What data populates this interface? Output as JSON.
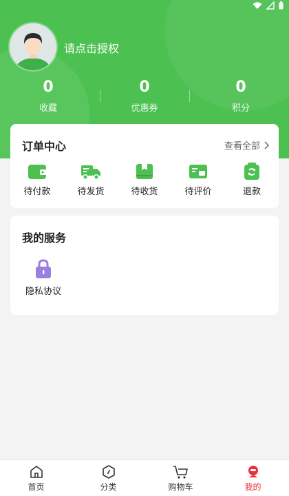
{
  "header": {
    "login_prompt": "请点击授权",
    "stats": [
      {
        "value": "0",
        "label": "收藏"
      },
      {
        "value": "0",
        "label": "优惠券"
      },
      {
        "value": "0",
        "label": "积分"
      }
    ]
  },
  "order_center": {
    "title": "订单中心",
    "view_all": "查看全部",
    "items": [
      {
        "label": "待付款",
        "icon": "wallet-icon"
      },
      {
        "label": "待发货",
        "icon": "truck-icon"
      },
      {
        "label": "待收货",
        "icon": "package-icon"
      },
      {
        "label": "待评价",
        "icon": "review-icon"
      },
      {
        "label": "退款",
        "icon": "refund-icon"
      }
    ]
  },
  "services": {
    "title": "我的服务",
    "items": [
      {
        "label": "隐私协议",
        "icon": "lock-icon"
      }
    ]
  },
  "tabbar": {
    "items": [
      {
        "label": "首页",
        "icon": "home-icon"
      },
      {
        "label": "分类",
        "icon": "category-icon"
      },
      {
        "label": "购物车",
        "icon": "cart-icon"
      },
      {
        "label": "我的",
        "icon": "profile-icon",
        "active": true
      }
    ]
  },
  "colors": {
    "brand_green": "#4cc151",
    "active_tab": "#e8303a",
    "service_icon": "#9b7fe0"
  }
}
